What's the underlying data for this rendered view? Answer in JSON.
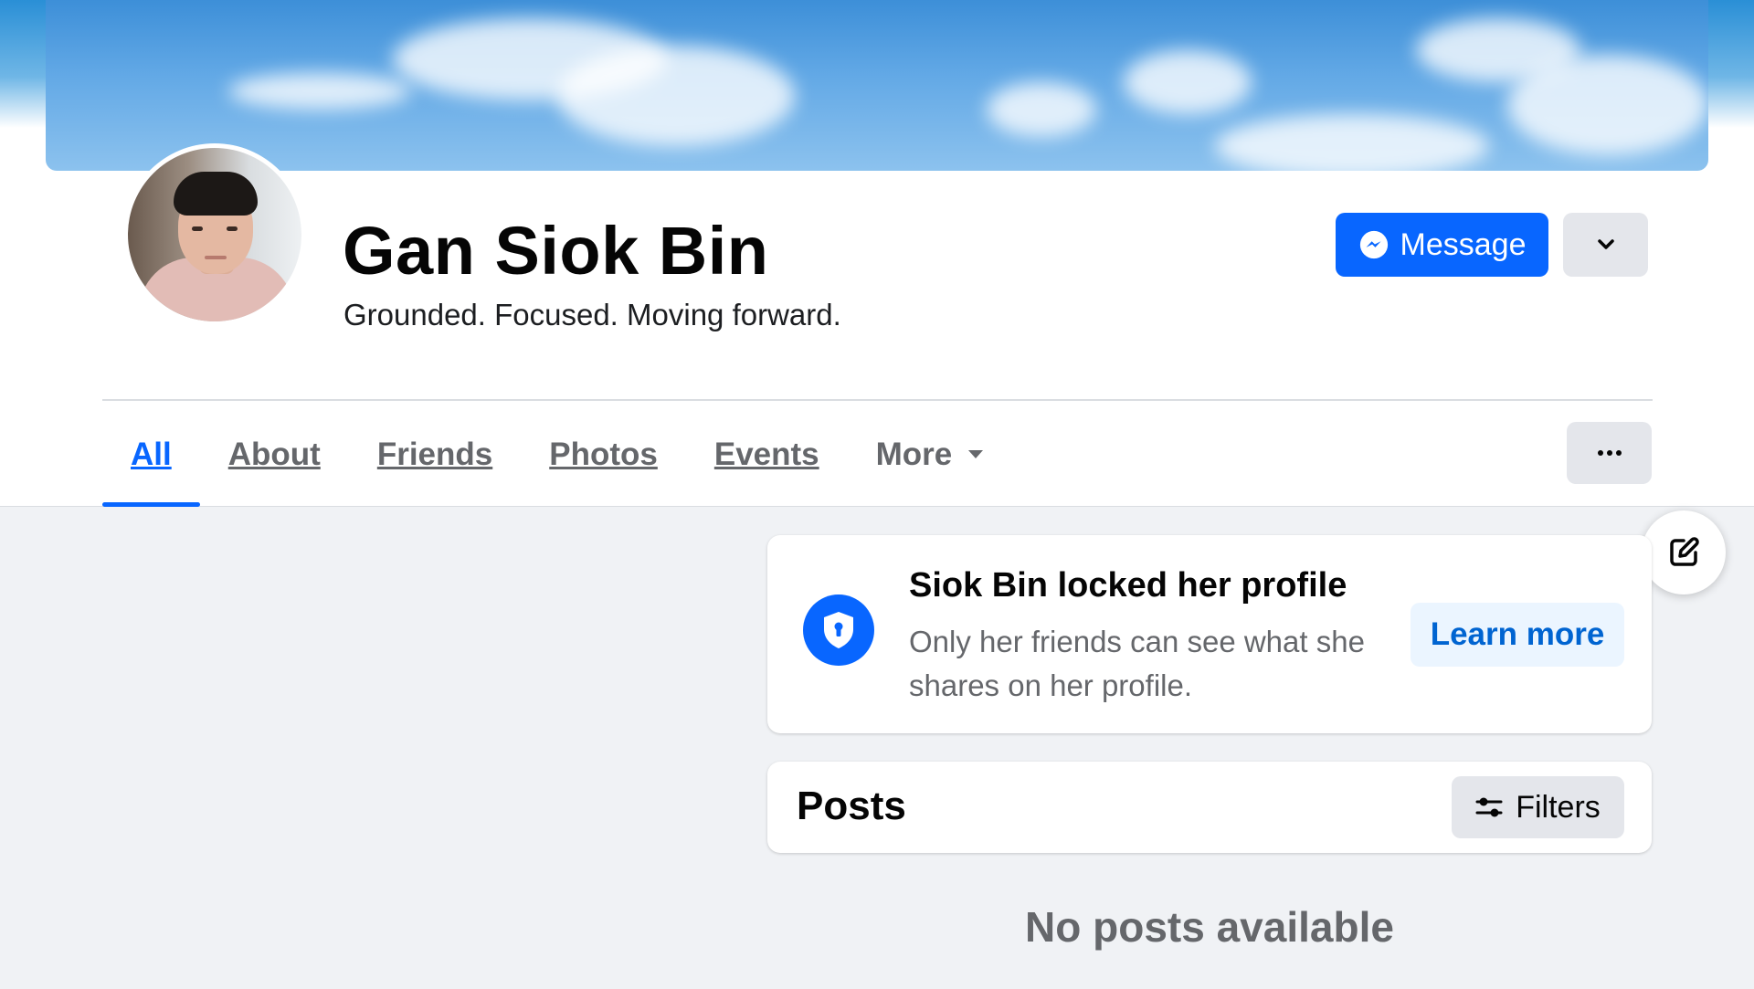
{
  "profile": {
    "name": "Gan Siok Bin",
    "bio": "Grounded. Focused. Moving forward."
  },
  "actions": {
    "message_label": "Message"
  },
  "tabs": [
    {
      "label": "All",
      "active": true
    },
    {
      "label": "About",
      "active": false
    },
    {
      "label": "Friends",
      "active": false
    },
    {
      "label": "Photos",
      "active": false
    },
    {
      "label": "Events",
      "active": false
    },
    {
      "label": "More",
      "active": false
    }
  ],
  "locked_notice": {
    "title": "Siok Bin locked her profile",
    "description": "Only her friends can see what she shares on her profile.",
    "learn_more_label": "Learn more"
  },
  "posts": {
    "title": "Posts",
    "filters_label": "Filters",
    "empty_text": "No posts available"
  },
  "icons": {
    "message": "messenger-icon",
    "dropdown": "chevron-down-icon",
    "more_options": "more-dots-icon",
    "lock": "shield-keyhole-icon",
    "filters": "sliders-icon",
    "compose": "edit-icon"
  },
  "colors": {
    "accent": "#0866ff",
    "secondary_button": "#e4e6eb",
    "page_background": "#f0f2f5",
    "muted_text": "#65676b"
  }
}
